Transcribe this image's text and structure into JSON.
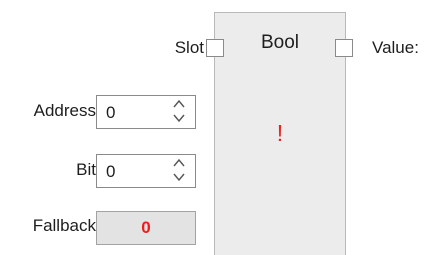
{
  "node": {
    "title": "Bool",
    "status_indicator": "!",
    "status_color": "#ee2222",
    "input_port": {
      "label": "Slot"
    },
    "output_port": {
      "label": "Value:"
    }
  },
  "properties": {
    "address": {
      "label": "Address",
      "value": "0"
    },
    "bit": {
      "label": "Bit",
      "value": "0"
    },
    "fallback": {
      "label": "Fallback",
      "value": "0",
      "value_color": "#ee1c1c"
    }
  },
  "icons": {
    "spin_up": "chevron-up-icon",
    "spin_down": "chevron-down-icon"
  }
}
